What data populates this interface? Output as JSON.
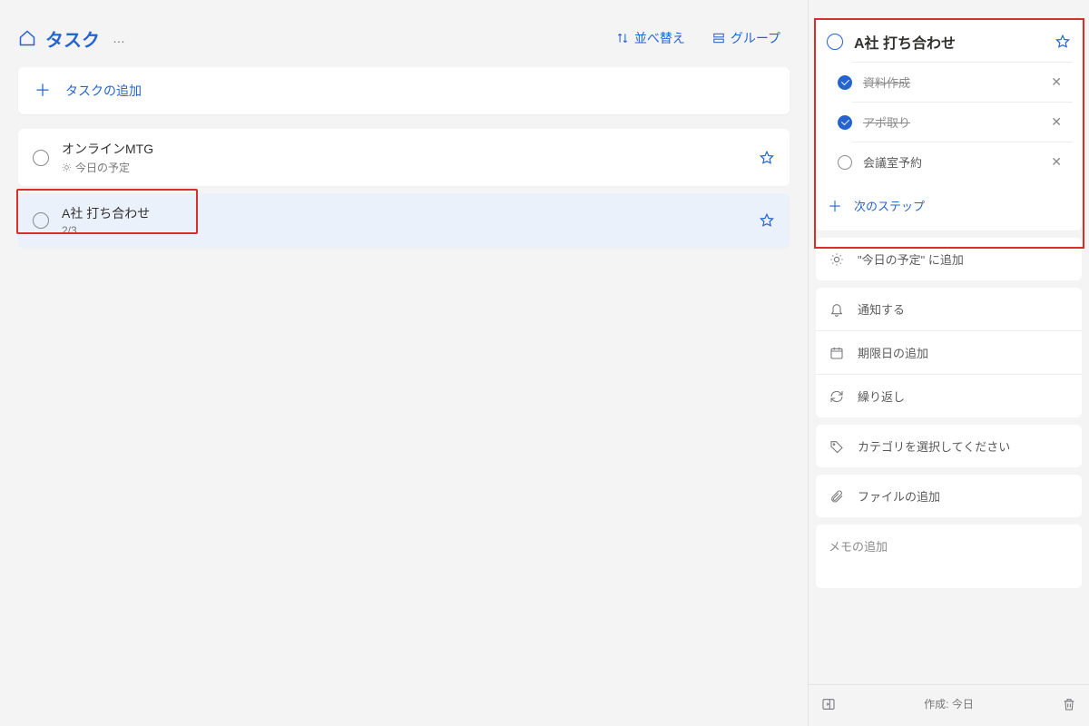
{
  "header": {
    "title": "タスク",
    "sort_label": "並べ替え",
    "group_label": "グループ"
  },
  "add_task_label": "タスクの追加",
  "tasks": [
    {
      "title": "オンラインMTG",
      "sub": "今日の予定",
      "progress": "",
      "selected": false
    },
    {
      "title": "A社  打ち合わせ",
      "sub": "",
      "progress": "2/3",
      "selected": true
    }
  ],
  "detail": {
    "title": "A社  打ち合わせ",
    "steps": [
      {
        "text": "資料作成",
        "done": true
      },
      {
        "text": "アポ取り",
        "done": true
      },
      {
        "text": "会議室予約",
        "done": false
      }
    ],
    "add_step_label": "次のステップ",
    "add_to_my_day": "\"今日の予定\" に追加",
    "remind": "通知する",
    "due": "期限日の追加",
    "repeat": "繰り返し",
    "category": "カテゴリを選択してください",
    "file": "ファイルの追加",
    "note_placeholder": "メモの追加",
    "created": "作成: 今日"
  }
}
